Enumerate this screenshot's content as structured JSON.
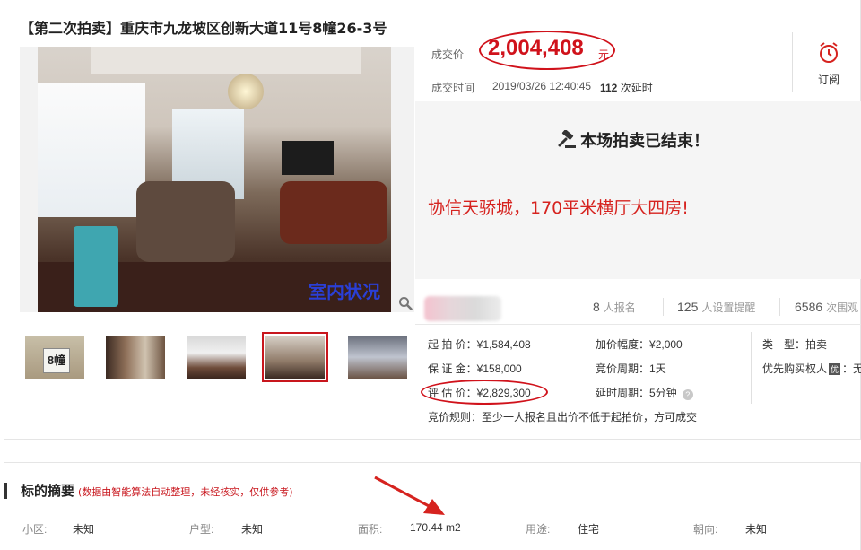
{
  "title": "【第二次拍卖】重庆市九龙坡区创新大道11号8幢26-3号",
  "photo": {
    "caption": "室内状况"
  },
  "thumbnails": [
    {
      "label": "8幢",
      "selected": false
    },
    {
      "label": "",
      "selected": false
    },
    {
      "label": "",
      "selected": false
    },
    {
      "label": "",
      "selected": true
    },
    {
      "label": "",
      "selected": false
    }
  ],
  "deal": {
    "price_label": "成交价",
    "price_value": "2,004,408",
    "price_unit": "元",
    "time_label": "成交时间",
    "time_value": "2019/03/26 12:40:45",
    "delay_count": "112",
    "delay_label": "次延时"
  },
  "subscribe": {
    "label": "订阅",
    "icon": "alarm-clock-icon"
  },
  "status": {
    "ended_text": "本场拍卖已结束！",
    "icon": "gavel-icon",
    "slogan": "协信天骄城，170平米横厅大四房!"
  },
  "stats": {
    "signups": "8",
    "signups_label": "人报名",
    "reminders": "125",
    "reminders_label": "人设置提醒",
    "views": "6586",
    "views_label": "次围观"
  },
  "info": {
    "start_price_label": "起 拍 价：",
    "start_price": "¥1,584,408",
    "deposit_label": "保 证 金：",
    "deposit": "¥158,000",
    "estimate_label": "评 估 价：",
    "estimate": "¥2,829,300",
    "increment_label": "加价幅度：",
    "increment": "¥2,000",
    "bid_cycle_label": "竞价周期：",
    "bid_cycle": "1天",
    "delay_cycle_label": "延时周期：",
    "delay_cycle": "5分钟",
    "type_label": "类　型：",
    "type": "拍卖",
    "priority_label": "优先购买权人",
    "priority_badge": "优",
    "priority_value": "：无",
    "rule_label": "竞价规则：",
    "rule": "至少一人报名且出价不低于起拍价，方可成交"
  },
  "summary": {
    "title": "标的摘要",
    "note": "(数据由智能算法自动整理，未经核实，仅供参考)",
    "items": [
      {
        "label": "小区:",
        "value": "未知"
      },
      {
        "label": "户型:",
        "value": "未知"
      },
      {
        "label": "面积:",
        "value": "170.44 m2"
      },
      {
        "label": "用途:",
        "value": "住宅"
      },
      {
        "label": "朝向:",
        "value": "未知"
      }
    ]
  },
  "colors": {
    "accent_red": "#d0121b",
    "annotation_red": "#d6231f"
  }
}
